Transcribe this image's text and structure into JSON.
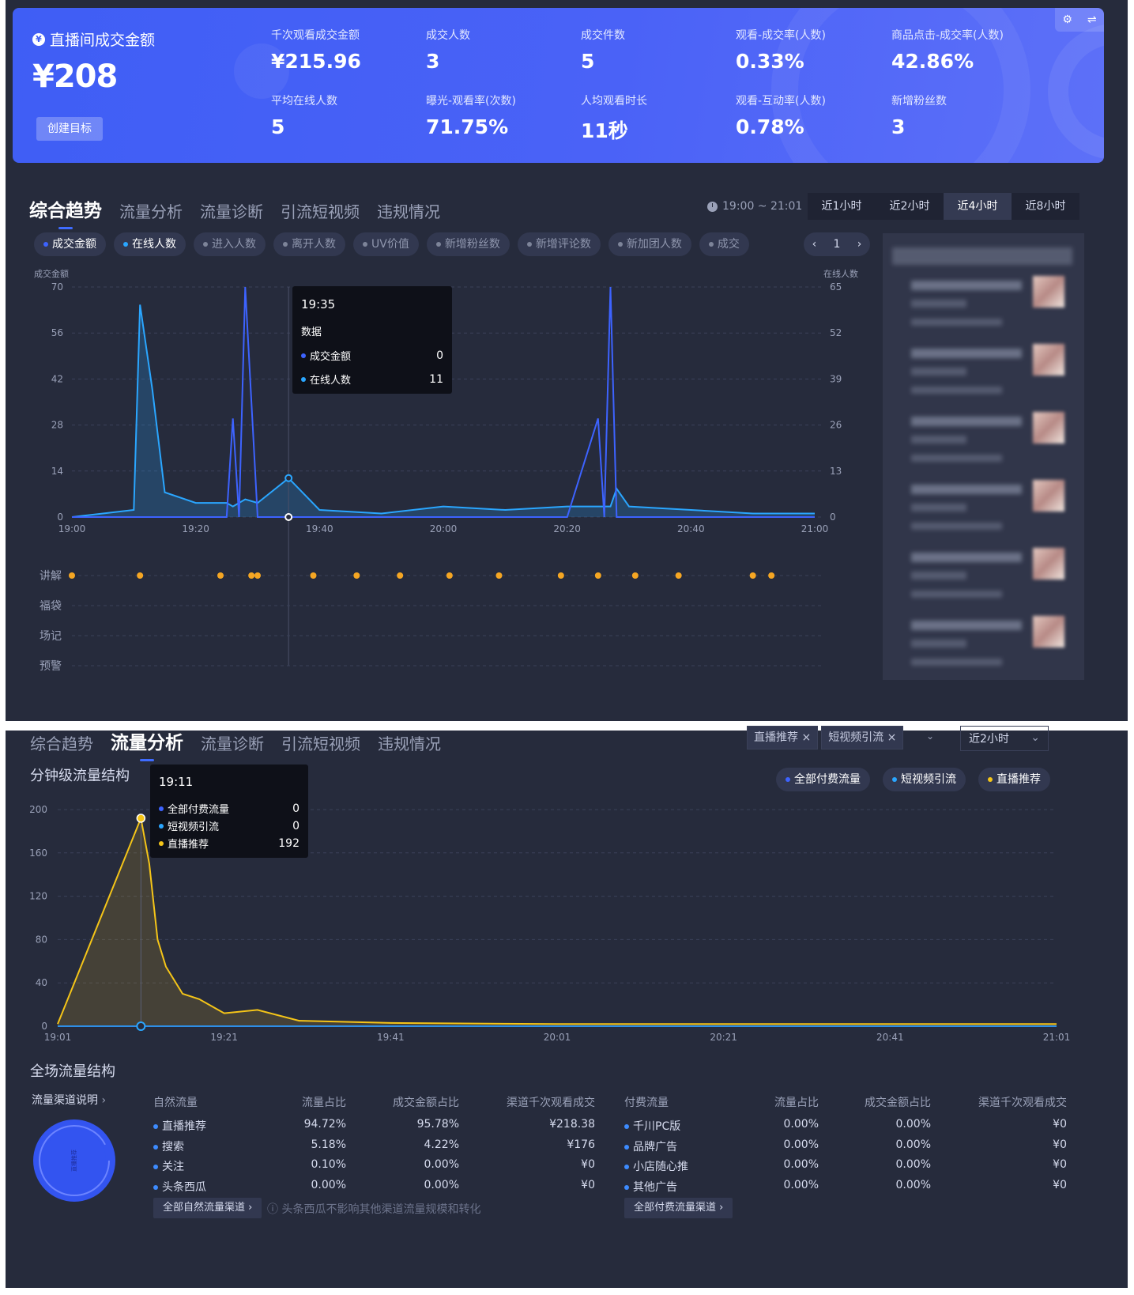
{
  "summary": {
    "gmv_label": "直播间成交金额",
    "gmv_value": "¥208",
    "create_goal": "创建目标",
    "metrics": [
      {
        "label": "千次观看成交金额",
        "value": "¥215.96"
      },
      {
        "label": "成交人数",
        "value": "3"
      },
      {
        "label": "成交件数",
        "value": "5"
      },
      {
        "label": "观看-成交率(人数)",
        "value": "0.33%"
      },
      {
        "label": "商品点击-成交率(人数)",
        "value": "42.86%"
      },
      {
        "label": "平均在线人数",
        "value": "5"
      },
      {
        "label": "曝光-观看率(次数)",
        "value": "71.75%"
      },
      {
        "label": "人均观看时长",
        "value": "11秒"
      },
      {
        "label": "观看-互动率(人数)",
        "value": "0.78%"
      },
      {
        "label": "新增粉丝数",
        "value": "3"
      }
    ]
  },
  "tabs": [
    "综合趋势",
    "流量分析",
    "流量诊断",
    "引流短视频",
    "违规情况"
  ],
  "trend": {
    "time_range": "19:00 ~ 21:01",
    "range_options": [
      "近1小时",
      "近2小时",
      "近4小时",
      "近8小时"
    ],
    "range_selected": "近4小时",
    "chips": [
      {
        "label": "成交金额",
        "color": "#3d63ff",
        "on": true
      },
      {
        "label": "在线人数",
        "color": "#2aa6ff",
        "on": true
      },
      {
        "label": "进入人数",
        "on": false
      },
      {
        "label": "离开人数",
        "on": false
      },
      {
        "label": "UV价值",
        "on": false
      },
      {
        "label": "新增粉丝数",
        "on": false
      },
      {
        "label": "新增评论数",
        "on": false
      },
      {
        "label": "新加团人数",
        "on": false
      },
      {
        "label": "成交",
        "on": false
      }
    ],
    "page": "1",
    "tooltip": {
      "time": "19:35",
      "title": "数据",
      "rows": [
        {
          "label": "成交金额",
          "value": "0",
          "color": "#3d63ff"
        },
        {
          "label": "在线人数",
          "value": "11",
          "color": "#2aa6ff"
        }
      ]
    },
    "event_rows": [
      "讲解",
      "福袋",
      "场记",
      "预警"
    ]
  },
  "traffic": {
    "filters": [
      "直播推荐 ×",
      "短视频引流 ×"
    ],
    "range_select": "近2小时",
    "minute_title": "分钟级流量结构",
    "legend": [
      {
        "label": "全部付费流量",
        "color": "#3d63ff"
      },
      {
        "label": "短视频引流",
        "color": "#2aa6ff"
      },
      {
        "label": "直播推荐",
        "color": "#f5c518"
      }
    ],
    "tooltip": {
      "time": "19:11",
      "rows": [
        {
          "label": "全部付费流量",
          "value": "0",
          "color": "#3d63ff"
        },
        {
          "label": "短视频引流",
          "value": "0",
          "color": "#2aa6ff"
        },
        {
          "label": "直播推荐",
          "value": "192",
          "color": "#f5c518"
        }
      ]
    },
    "structure_title": "全场流量结构",
    "channel_link": "流量渠道说明",
    "natural_header": [
      "自然流量",
      "流量占比",
      "成交金额占比",
      "渠道千次观看成交"
    ],
    "natural_rows": [
      [
        "直播推荐",
        "94.72%",
        "95.78%",
        "¥218.38"
      ],
      [
        "搜索",
        "5.18%",
        "4.22%",
        "¥176"
      ],
      [
        "关注",
        "0.10%",
        "0.00%",
        "¥0"
      ],
      [
        "头条西瓜",
        "0.00%",
        "0.00%",
        "¥0"
      ]
    ],
    "paid_header": [
      "付费流量",
      "流量占比",
      "成交金额占比",
      "渠道千次观看成交"
    ],
    "paid_rows": [
      [
        "千川PC版",
        "0.00%",
        "0.00%",
        "¥0"
      ],
      [
        "品牌广告",
        "0.00%",
        "0.00%",
        "¥0"
      ],
      [
        "小店随心推",
        "0.00%",
        "0.00%",
        "¥0"
      ],
      [
        "其他广告",
        "0.00%",
        "0.00%",
        "¥0"
      ]
    ],
    "all_natural_btn": "全部自然流量渠道 ›",
    "all_paid_btn": "全部付费流量渠道 ›",
    "note": "头条西瓜不影响其他渠道流量规模和转化",
    "donut_label": "直播推荐"
  },
  "chart_data": [
    {
      "type": "line",
      "title": "",
      "x": [
        "19:00",
        "19:05",
        "19:10",
        "19:11",
        "19:13",
        "19:15",
        "19:20",
        "19:25",
        "19:26",
        "19:27",
        "19:28",
        "19:30",
        "19:35",
        "19:40",
        "19:50",
        "20:00",
        "20:10",
        "20:20",
        "20:25",
        "20:26",
        "20:27",
        "20:28",
        "20:30",
        "20:40",
        "20:50",
        "21:00"
      ],
      "xticks": [
        "19:00",
        "19:20",
        "19:40",
        "20:00",
        "20:20",
        "20:40",
        "21:00"
      ],
      "ylabel": "成交金额",
      "y2label": "在线人数",
      "ylim": [
        0,
        70
      ],
      "y2lim": [
        0,
        65
      ],
      "yticks": [
        0,
        14,
        28,
        42,
        56,
        70
      ],
      "y2ticks": [
        0,
        13,
        26,
        39,
        52,
        65
      ],
      "series": [
        {
          "name": "成交金额",
          "color": "#3d63ff",
          "values": [
            0,
            0,
            0,
            0,
            0,
            0,
            0,
            0,
            30,
            0,
            70,
            0,
            0,
            0,
            0,
            0,
            0,
            0,
            30,
            0,
            70,
            0,
            0,
            0,
            0,
            0
          ]
        },
        {
          "name": "在线人数",
          "color": "#2aa6ff",
          "values": [
            0,
            1,
            2,
            60,
            36,
            7,
            4,
            4,
            3,
            4,
            5,
            4,
            11,
            2,
            1,
            3,
            2,
            3,
            3,
            3,
            3,
            8,
            3,
            2,
            1,
            1
          ]
        }
      ],
      "events": {
        "讲解": [
          "19:00",
          "19:11",
          "19:24",
          "19:29",
          "19:30",
          "19:39",
          "19:46",
          "19:53",
          "20:01",
          "20:09",
          "20:19",
          "20:25",
          "20:31",
          "20:38",
          "20:50",
          "20:53"
        ]
      }
    },
    {
      "type": "area",
      "title": "分钟级流量结构",
      "x": [
        "19:01",
        "19:11",
        "19:12",
        "19:13",
        "19:14",
        "19:16",
        "19:18",
        "19:21",
        "19:25",
        "19:30",
        "19:41",
        "20:01",
        "20:21",
        "20:41",
        "21:01"
      ],
      "xticks": [
        "19:01",
        "19:21",
        "19:41",
        "20:01",
        "20:21",
        "20:41",
        "21:01"
      ],
      "ylim": [
        0,
        200
      ],
      "yticks": [
        0,
        40,
        80,
        120,
        160,
        200
      ],
      "series": [
        {
          "name": "全部付费流量",
          "color": "#3d63ff",
          "values": [
            0,
            0,
            0,
            0,
            0,
            0,
            0,
            0,
            0,
            0,
            0,
            0,
            0,
            0,
            0
          ]
        },
        {
          "name": "短视频引流",
          "color": "#2aa6ff",
          "values": [
            0,
            0,
            0,
            0,
            0,
            0,
            0,
            0,
            0,
            0,
            0,
            0,
            0,
            0,
            0
          ]
        },
        {
          "name": "直播推荐",
          "color": "#f5c518",
          "values": [
            2,
            192,
            150,
            80,
            55,
            30,
            25,
            12,
            15,
            5,
            3,
            2,
            2,
            2,
            2
          ]
        }
      ]
    }
  ]
}
